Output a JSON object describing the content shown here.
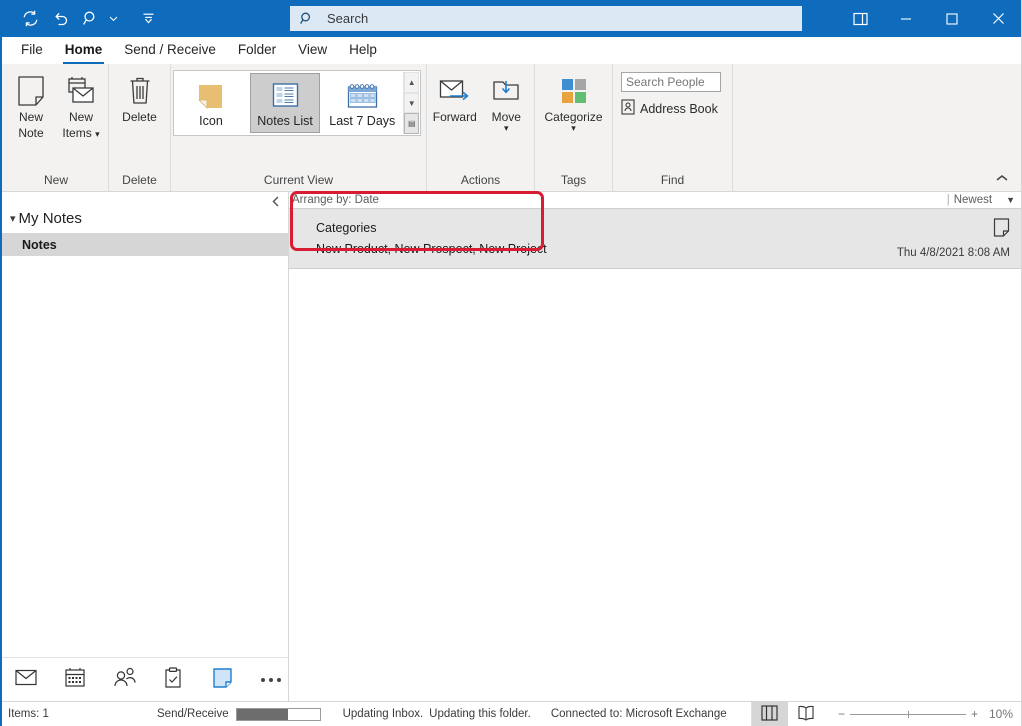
{
  "titlebar": {
    "quick_access": [
      {
        "name": "send-receive-all-icon",
        "label": "Send/Receive All Folders"
      },
      {
        "name": "undo-icon",
        "label": "Undo"
      },
      {
        "name": "search-qat-icon",
        "label": "Search"
      },
      {
        "name": "customize-qat-icon",
        "label": "Customize Quick Access Toolbar"
      }
    ],
    "search_placeholder": "Search",
    "search_icon": "search-icon",
    "window_controls": [
      {
        "name": "ribbon-display-options-button",
        "glyph": "ribbon"
      },
      {
        "name": "minimize-button",
        "glyph": "minimize"
      },
      {
        "name": "maximize-button",
        "glyph": "maximize"
      },
      {
        "name": "close-button",
        "glyph": "close"
      }
    ],
    "accent_color": "#0f6cbd"
  },
  "tabs": [
    {
      "label": "File",
      "active": false
    },
    {
      "label": "Home",
      "active": true
    },
    {
      "label": "Send / Receive",
      "active": false
    },
    {
      "label": "Folder",
      "active": false
    },
    {
      "label": "View",
      "active": false
    },
    {
      "label": "Help",
      "active": false
    }
  ],
  "ribbon": {
    "collapse_icon": "chevron-up-icon",
    "groups": [
      {
        "name": "new",
        "label": "New",
        "buttons": [
          {
            "name": "new-note-button",
            "line1": "New",
            "line2": "Note",
            "icon": "note-icon",
            "has_dropdown": false
          },
          {
            "name": "new-items-button",
            "line1": "New",
            "line2": "Items",
            "icon": "new-items-icon",
            "has_dropdown": true
          }
        ]
      },
      {
        "name": "delete",
        "label": "Delete",
        "buttons": [
          {
            "name": "delete-button",
            "line1": "Delete",
            "line2": "",
            "icon": "trash-icon",
            "has_dropdown": false
          }
        ]
      },
      {
        "name": "current-view",
        "label": "Current View",
        "gallery": [
          {
            "name": "view-icon-button",
            "label": "Icon",
            "icon": "yellow-note-icon",
            "selected": false
          },
          {
            "name": "view-notes-list-button",
            "label": "Notes List",
            "icon": "notes-list-icon",
            "selected": true
          },
          {
            "name": "view-last-7-days-button",
            "label": "Last 7 Days",
            "icon": "calendar-icon",
            "selected": false
          }
        ],
        "scroll_buttons": [
          {
            "name": "gallery-scroll-up-button",
            "glyph": "up"
          },
          {
            "name": "gallery-scroll-down-button",
            "glyph": "down"
          },
          {
            "name": "gallery-more-button",
            "glyph": "more"
          }
        ]
      },
      {
        "name": "actions",
        "label": "Actions",
        "buttons": [
          {
            "name": "forward-button",
            "line1": "Forward",
            "line2": "",
            "icon": "forward-icon",
            "has_dropdown": false
          },
          {
            "name": "move-button",
            "line1": "Move",
            "line2": "",
            "icon": "move-icon",
            "has_dropdown": true
          }
        ]
      },
      {
        "name": "tags",
        "label": "Tags",
        "buttons": [
          {
            "name": "categorize-button",
            "line1": "Categorize",
            "line2": "",
            "icon": "categorize-icon",
            "has_dropdown": true
          }
        ]
      },
      {
        "name": "find",
        "label": "Find",
        "search_people_placeholder": "Search People",
        "address_book_label": "Address Book",
        "address_book_icon": "address-book-icon"
      }
    ]
  },
  "navpane": {
    "collapse_icon": "collapse-pane-icon",
    "header": "My Notes",
    "header_chevron": "chevron-down-icon",
    "items": [
      {
        "label": "Notes",
        "selected": true
      }
    ],
    "bottom_bar": [
      {
        "name": "nav-mail-button",
        "icon": "mail-icon",
        "active": false
      },
      {
        "name": "nav-calendar-button",
        "icon": "calendar-icon",
        "active": false
      },
      {
        "name": "nav-people-button",
        "icon": "people-icon",
        "active": false
      },
      {
        "name": "nav-tasks-button",
        "icon": "tasks-icon",
        "active": false
      },
      {
        "name": "nav-notes-button",
        "icon": "notes-icon",
        "active": true
      },
      {
        "name": "nav-more-button",
        "icon": "ellipsis-icon",
        "active": false
      }
    ]
  },
  "listpane": {
    "arrange_by": "Arrange by: Date",
    "sort_separator": "|",
    "sort_label": "Newest",
    "sort_caret": "chevron-down-icon",
    "rows": [
      {
        "title": "Categories",
        "subtitle": "New Product, New Prospect, New Project",
        "date": "Thu 4/8/2021 8:08 AM",
        "icon": "note-icon",
        "selected": true,
        "highlighted": true
      }
    ],
    "highlight_color": "#d81c33"
  },
  "statusbar": {
    "items_count": "Items: 1",
    "send_receive_label": "Send/Receive",
    "progress_percent": 62,
    "message_1": "Updating Inbox.",
    "message_2": "Updating this folder.",
    "connection": "Connected to: Microsoft Exchange",
    "view_buttons": [
      {
        "name": "normal-view-button",
        "icon": "normal-view-icon",
        "active": true
      },
      {
        "name": "reading-view-button",
        "icon": "reading-view-icon",
        "active": false
      }
    ],
    "zoom_out_label": "−",
    "zoom_in_label": "+",
    "zoom_level": "10%"
  }
}
